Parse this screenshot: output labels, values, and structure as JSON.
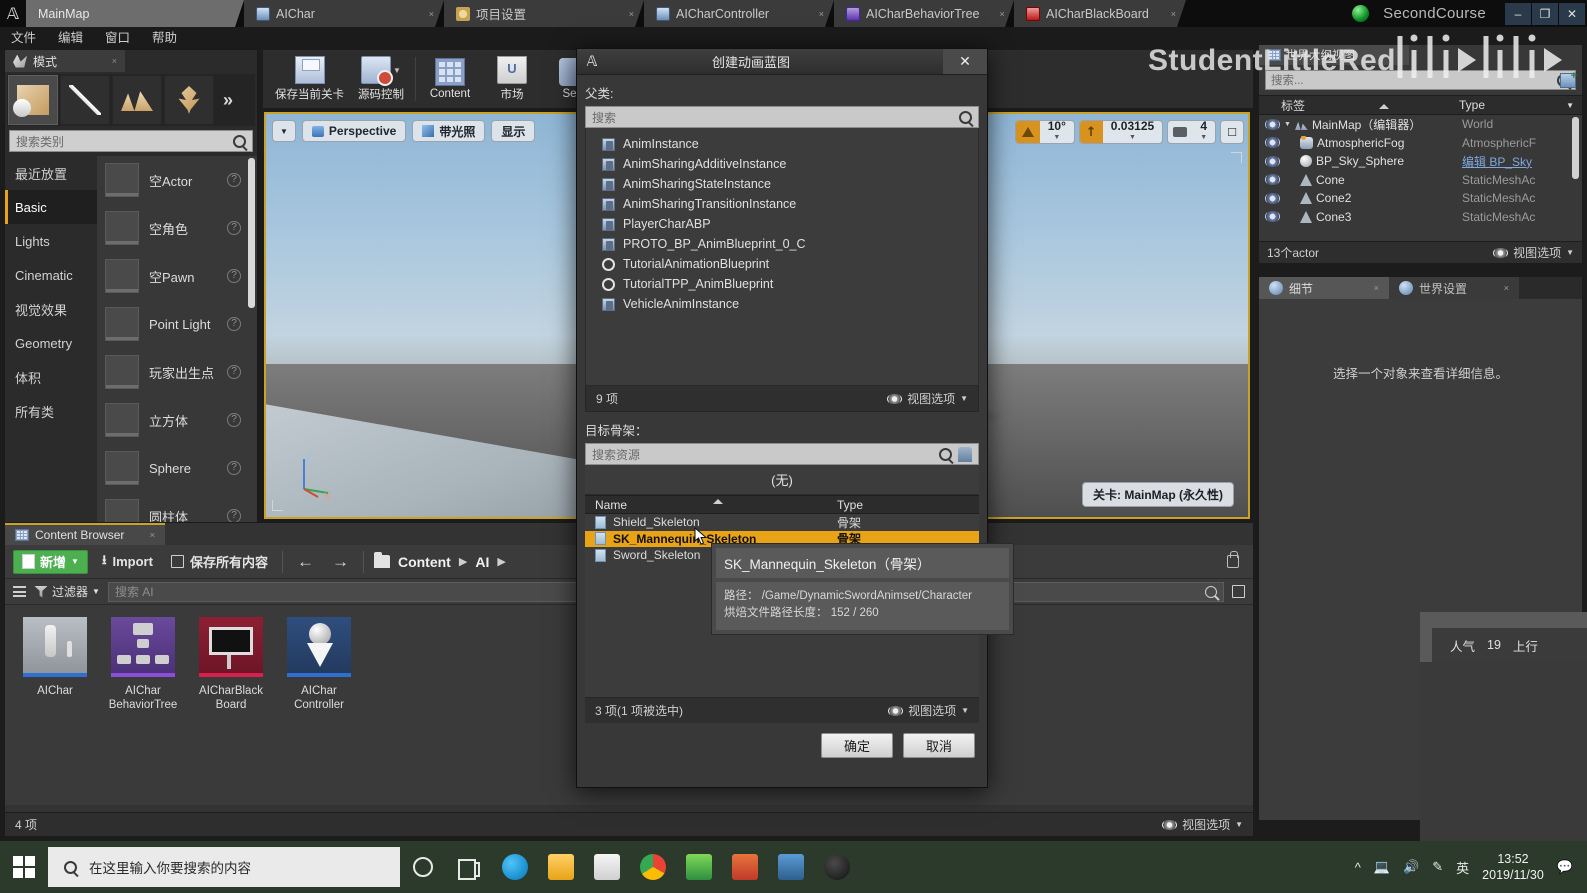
{
  "tabbar": {
    "tabs": [
      {
        "label": "MainMap",
        "icon": "none",
        "active": true
      },
      {
        "label": "AIChar",
        "icon": "blueprint-icon",
        "closable": true
      },
      {
        "label": "项目设置",
        "icon": "gear-icon",
        "closable": true
      },
      {
        "label": "AICharController",
        "icon": "blueprint-icon",
        "closable": true
      },
      {
        "label": "AICharBehaviorTree",
        "icon": "behavior-tree-icon",
        "closable": true
      },
      {
        "label": "AICharBlackBoard",
        "icon": "blackboard-icon",
        "closable": true
      }
    ],
    "project_name": "SecondCourse",
    "minimize": "–",
    "maximize": "❐",
    "close": "✕"
  },
  "menubar": {
    "items": [
      "文件",
      "编辑",
      "窗口",
      "帮助"
    ]
  },
  "modes": {
    "tab_label": "模式",
    "tab_close": "×",
    "search_placeholder": "搜索类别",
    "categories": [
      {
        "label": "最近放置",
        "selected": false
      },
      {
        "label": "Basic",
        "selected": true
      },
      {
        "label": "Lights",
        "selected": false
      },
      {
        "label": "Cinematic",
        "selected": false
      },
      {
        "label": "视觉效果",
        "selected": false
      },
      {
        "label": "Geometry",
        "selected": false
      },
      {
        "label": "体积",
        "selected": false
      },
      {
        "label": "所有类",
        "selected": false
      }
    ],
    "items": [
      {
        "label": "空Actor",
        "thumb": "sphere"
      },
      {
        "label": "空角色",
        "thumb": "char"
      },
      {
        "label": "空Pawn",
        "thumb": "pawn"
      },
      {
        "label": "Point Light",
        "thumb": "bulb"
      },
      {
        "label": "玩家出生点",
        "thumb": "flag"
      },
      {
        "label": "立方体",
        "thumb": "cube"
      },
      {
        "label": "Sphere",
        "thumb": "sphere"
      },
      {
        "label": "圆柱体",
        "thumb": "cyl"
      }
    ],
    "help_glyph": "?"
  },
  "toolbar": {
    "buttons": [
      {
        "label": "保存当前关卡",
        "icon": "save-icon"
      },
      {
        "label": "源码控制",
        "icon": "source-control-icon",
        "has_dropdown": true
      },
      {
        "label": "Content",
        "icon": "content-icon"
      },
      {
        "label": "市场",
        "icon": "marketplace-icon"
      },
      {
        "label": "Setti",
        "icon": "settings-icon"
      }
    ]
  },
  "viewport": {
    "perspective_label": "Perspective",
    "lit_label": "带光照",
    "show_label": "显示",
    "angle_snap": "10°",
    "scale_snap": "0.03125",
    "camera_speed": "4",
    "level_badge": "关卡: MainMap (永久性)",
    "axis_labels": {
      "z": "Z",
      "x": "X",
      "y": "Y"
    }
  },
  "outliner": {
    "tab_label": "世界大纲视图",
    "search_placeholder": "搜索...",
    "columns": [
      "标签",
      "Type"
    ],
    "rows": [
      {
        "name": "MainMap（编辑器）",
        "type": "World",
        "icon": "world-icon",
        "indent": 0,
        "expander": "▼"
      },
      {
        "name": "AtmosphericFog",
        "type": "AtmosphericF",
        "icon": "fog-icon",
        "indent": 1
      },
      {
        "name": "BP_Sky_Sphere",
        "type": "编辑 BP_Sky",
        "icon": "sky-icon",
        "indent": 1,
        "type_is_link": true
      },
      {
        "name": "Cone",
        "type": "StaticMeshAc",
        "icon": "cone-icon",
        "indent": 1
      },
      {
        "name": "Cone2",
        "type": "StaticMeshAc",
        "icon": "cone-icon",
        "indent": 1
      },
      {
        "name": "Cone3",
        "type": "StaticMeshAc",
        "icon": "cone-icon",
        "indent": 1
      }
    ],
    "footer_count": "13个actor",
    "view_options": "视图选项"
  },
  "details": {
    "tabs": [
      {
        "label": "细节",
        "active": true,
        "icon": "details-icon"
      },
      {
        "label": "世界设置",
        "active": false,
        "icon": "world-settings-icon"
      }
    ],
    "empty_message": "选择一个对象来查看详细信息。"
  },
  "content_browser": {
    "tab_label": "Content Browser",
    "add_label": "新增",
    "import_label": "Import",
    "save_all_label": "保存所有内容",
    "breadcrumbs": [
      "Content",
      "AI"
    ],
    "filter_label": "过滤器",
    "search_placeholder": "搜索 AI",
    "assets": [
      {
        "label": "AIChar",
        "thumb": "mannequin"
      },
      {
        "label": "AIChar\nBehaviorTree",
        "thumb": "behaviortree"
      },
      {
        "label": "AICharBlack\nBoard",
        "thumb": "blackboard"
      },
      {
        "label": "AIChar\nController",
        "thumb": "controller"
      }
    ],
    "footer_count": "4 项",
    "view_options": "视图选项"
  },
  "dialog": {
    "title": "创建动画蓝图",
    "close": "✕",
    "parent_label": "父类:",
    "search_placeholder": "搜索",
    "parent_classes": [
      {
        "label": "AnimInstance",
        "icon": "class-icon"
      },
      {
        "label": "AnimSharingAdditiveInstance",
        "icon": "class-icon"
      },
      {
        "label": "AnimSharingStateInstance",
        "icon": "class-icon"
      },
      {
        "label": "AnimSharingTransitionInstance",
        "icon": "class-icon"
      },
      {
        "label": "PlayerCharABP",
        "icon": "class-icon"
      },
      {
        "label": "PROTO_BP_AnimBlueprint_0_C",
        "icon": "class-icon"
      },
      {
        "label": "TutorialAnimationBlueprint",
        "icon": "ring-icon"
      },
      {
        "label": "TutorialTPP_AnimBlueprint",
        "icon": "ring-icon"
      },
      {
        "label": "VehicleAnimInstance",
        "icon": "class-icon"
      }
    ],
    "parent_count": "9 项",
    "parent_view_options": "视图选项",
    "skeleton_label": "目标骨架：",
    "skeleton_search_placeholder": "搜索资源",
    "none_label": "(无)",
    "skeleton_columns": [
      "Name",
      "Type"
    ],
    "skeletons": [
      {
        "name": "Shield_Skeleton",
        "type": "骨架",
        "selected": false
      },
      {
        "name": "SK_Mannequin_Skeleton",
        "type": "骨架",
        "selected": true
      },
      {
        "name": "Sword_Skeleton",
        "type": "骨架",
        "selected": false
      }
    ],
    "skeleton_count": "3 项(1 项被选中)",
    "skeleton_view_options": "视图选项",
    "ok_label": "确定",
    "cancel_label": "取消"
  },
  "tooltip": {
    "title": "SK_Mannequin_Skeleton（骨架）",
    "path_label": "路径：",
    "path_value": "/Game/DynamicSwordAnimset/Character",
    "bake_label": "烘焙文件路径长度：",
    "bake_value": "152 / 260"
  },
  "watermark": {
    "text": "StudentLittleRed",
    "brand": "bilibili",
    "popularity_label": "人气",
    "popularity_value": "19",
    "uplink_label": "上行"
  },
  "taskbar": {
    "search_placeholder": "在这里输入你要搜索的内容",
    "ime": "英",
    "time": "13:52",
    "date": "2019/11/30"
  },
  "colors": {
    "accent_orange": "#e8a317",
    "highlight_gold": "#c9a227",
    "add_green": "#4caf50"
  }
}
